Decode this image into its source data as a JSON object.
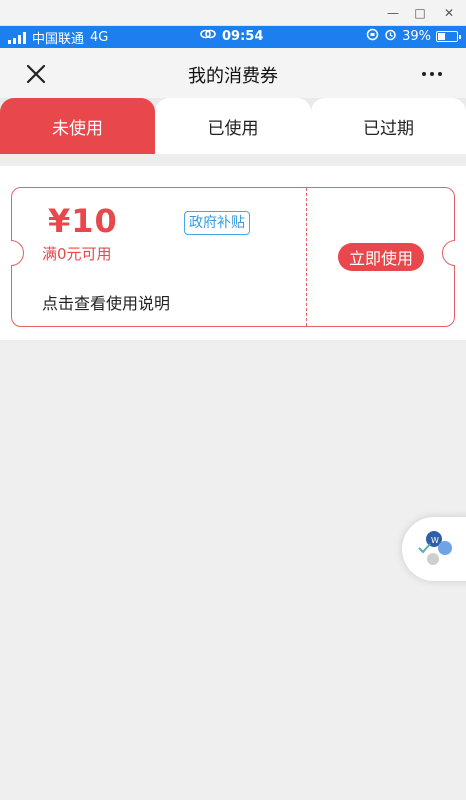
{
  "window": {
    "minimize": "—",
    "maximize": "□",
    "close": "✕"
  },
  "status_bar": {
    "carrier": "中国联通",
    "network": "4G",
    "time": "09:54",
    "battery": "39%",
    "battery_level": 0.39
  },
  "header": {
    "title": "我的消费券"
  },
  "tabs": [
    {
      "label": "未使用",
      "active": true
    },
    {
      "label": "已使用",
      "active": false
    },
    {
      "label": "已过期",
      "active": false
    }
  ],
  "coupon": {
    "amount": "¥10",
    "condition": "满0元可用",
    "badge": "政府补贴",
    "hint": "点击查看使用说明",
    "action": "立即使用"
  },
  "colors": {
    "accent": "#e8484c",
    "status_bar": "#1c7ff0",
    "badge": "#3a9be0"
  },
  "icons": [
    "close-icon",
    "more-icon",
    "signal-icon",
    "link-icon",
    "alarm-icon",
    "battery-icon",
    "floating-widget-icon"
  ]
}
